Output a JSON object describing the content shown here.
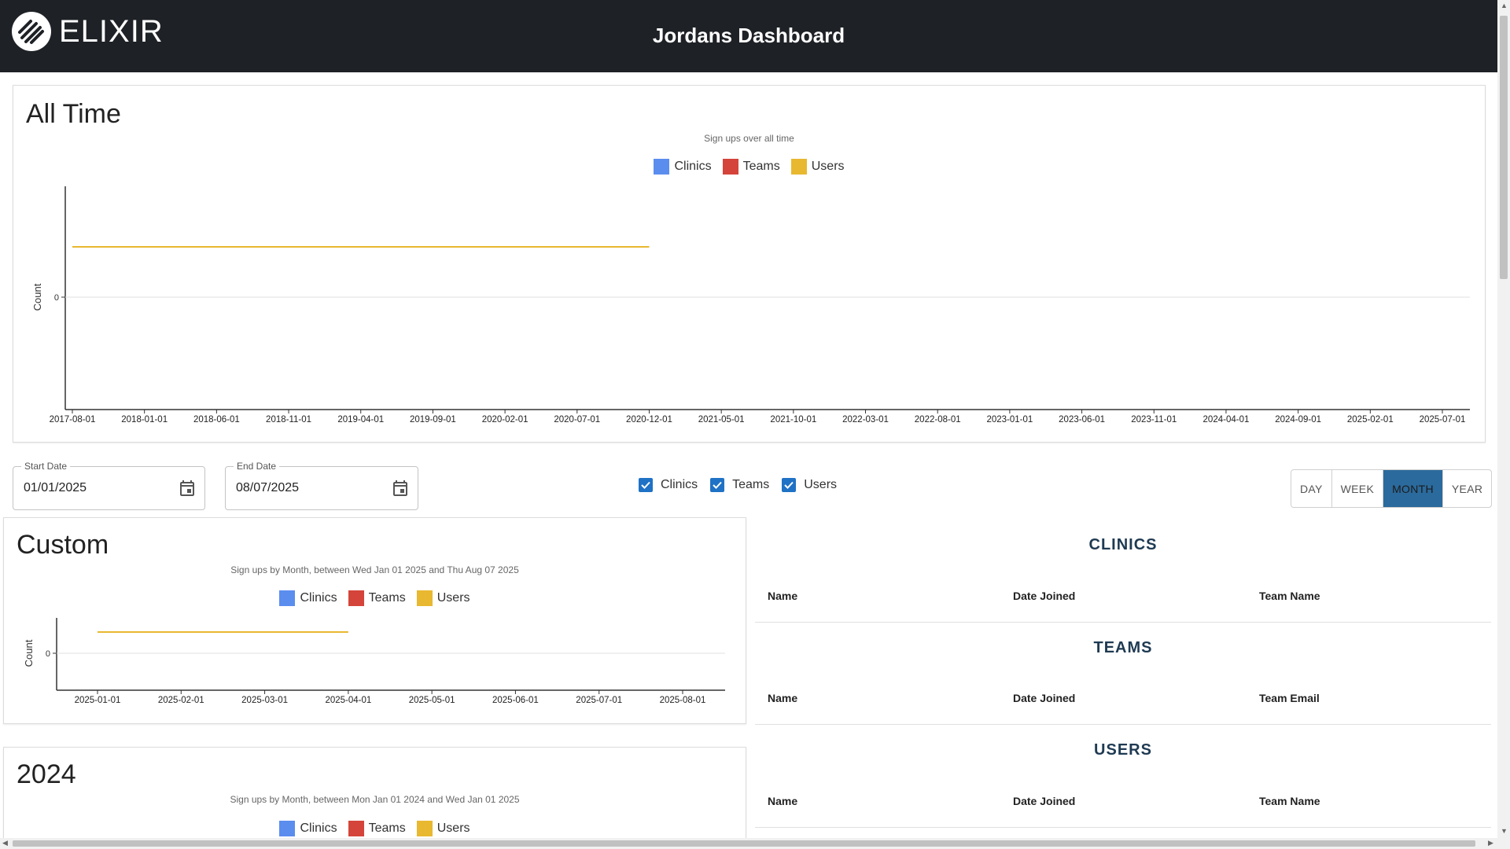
{
  "header": {
    "logo_text": "ELIXIR",
    "title": "Jordans Dashboard"
  },
  "all_time": {
    "title": "All Time",
    "subtitle": "Sign ups over all time"
  },
  "legend": [
    "Clinics",
    "Teams",
    "Users"
  ],
  "colors": {
    "clinics": "#5b8def",
    "teams": "#d4443a",
    "users": "#e8b830",
    "toggle_active": "#2b6a9c",
    "checkbox": "#1f72c5",
    "header_bg": "#1e2126"
  },
  "filters": {
    "start_label": "Start Date",
    "start_value": "01/01/2025",
    "end_label": "End Date",
    "end_value": "08/07/2025",
    "checkboxes": [
      "Clinics",
      "Teams",
      "Users"
    ],
    "checked": [
      true,
      true,
      true
    ],
    "granularity": [
      "DAY",
      "WEEK",
      "MONTH",
      "YEAR"
    ],
    "selected_granularity": "MONTH"
  },
  "custom": {
    "title": "Custom",
    "subtitle": "Sign ups by Month, between Wed Jan 01 2025 and Thu Aug 07 2025"
  },
  "y2024": {
    "title": "2024",
    "subtitle": "Sign ups by Month, between Mon Jan 01 2024 and Wed Jan 01 2025"
  },
  "tables": {
    "clinics": {
      "title": "CLINICS",
      "columns": [
        "Name",
        "Date Joined",
        "Team Name"
      ]
    },
    "teams": {
      "title": "TEAMS",
      "columns": [
        "Name",
        "Date Joined",
        "Team Email"
      ]
    },
    "users": {
      "title": "USERS",
      "columns": [
        "Name",
        "Date Joined",
        "Team Name"
      ]
    }
  },
  "chart_data": [
    {
      "type": "line",
      "title": "Sign ups over all time",
      "ylabel": "Count",
      "xlabel": "",
      "y_ticks": [
        "0"
      ],
      "x": [
        "2017-08-01",
        "2018-01-01",
        "2018-06-01",
        "2018-11-01",
        "2019-04-01",
        "2019-09-01",
        "2020-02-01",
        "2020-07-01",
        "2020-12-01",
        "2021-05-01",
        "2021-10-01",
        "2022-03-01",
        "2022-08-01",
        "2023-01-01",
        "2023-06-01",
        "2023-11-01",
        "2024-04-01",
        "2024-09-01",
        "2025-02-01",
        "2025-07-01"
      ],
      "series": [
        {
          "name": "Clinics",
          "values": []
        },
        {
          "name": "Teams",
          "values": []
        },
        {
          "name": "Users",
          "values": [
            {
              "x": "2017-08-01",
              "y": 1
            },
            {
              "x": "2020-12-01",
              "y": 1
            }
          ]
        }
      ],
      "legend": "top-center",
      "grid": false
    },
    {
      "type": "line",
      "title": "Sign ups by Month, between Wed Jan 01 2025 and Thu Aug 07 2025",
      "ylabel": "Count",
      "xlabel": "",
      "y_ticks": [
        "0"
      ],
      "x": [
        "2025-01-01",
        "2025-02-01",
        "2025-03-01",
        "2025-04-01",
        "2025-05-01",
        "2025-06-01",
        "2025-07-01",
        "2025-08-01"
      ],
      "series": [
        {
          "name": "Clinics",
          "values": []
        },
        {
          "name": "Teams",
          "values": []
        },
        {
          "name": "Users",
          "values": [
            {
              "x": "2025-01-01",
              "y": 1
            },
            {
              "x": "2025-04-01",
              "y": 1
            }
          ]
        }
      ],
      "legend": "top-center",
      "grid": false
    }
  ]
}
